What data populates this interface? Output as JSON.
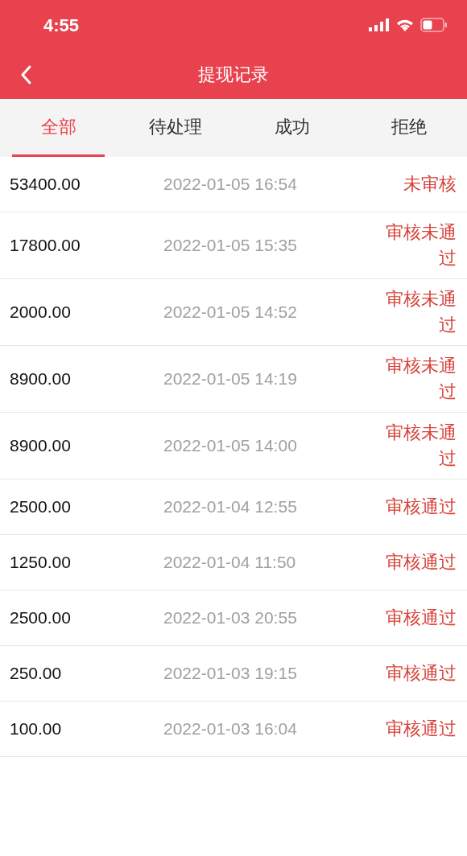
{
  "status_bar": {
    "time": "4:55"
  },
  "header": {
    "title": "提现记录"
  },
  "tabs": [
    {
      "label": "全部",
      "selected": true
    },
    {
      "label": "待处理",
      "selected": false
    },
    {
      "label": "成功",
      "selected": false
    },
    {
      "label": "拒绝",
      "selected": false
    }
  ],
  "records": [
    {
      "amount": "53400.00",
      "time": "2022-01-05 16:54",
      "status": "未审核"
    },
    {
      "amount": "17800.00",
      "time": "2022-01-05 15:35",
      "status": "审核未通过"
    },
    {
      "amount": "2000.00",
      "time": "2022-01-05 14:52",
      "status": "审核未通过"
    },
    {
      "amount": "8900.00",
      "time": "2022-01-05 14:19",
      "status": "审核未通过"
    },
    {
      "amount": "8900.00",
      "time": "2022-01-05 14:00",
      "status": "审核未通过"
    },
    {
      "amount": "2500.00",
      "time": "2022-01-04 12:55",
      "status": "审核通过"
    },
    {
      "amount": "1250.00",
      "time": "2022-01-04 11:50",
      "status": "审核通过"
    },
    {
      "amount": "2500.00",
      "time": "2022-01-03 20:55",
      "status": "审核通过"
    },
    {
      "amount": "250.00",
      "time": "2022-01-03 19:15",
      "status": "审核通过"
    },
    {
      "amount": "100.00",
      "time": "2022-01-03 16:04",
      "status": "审核通过"
    }
  ]
}
